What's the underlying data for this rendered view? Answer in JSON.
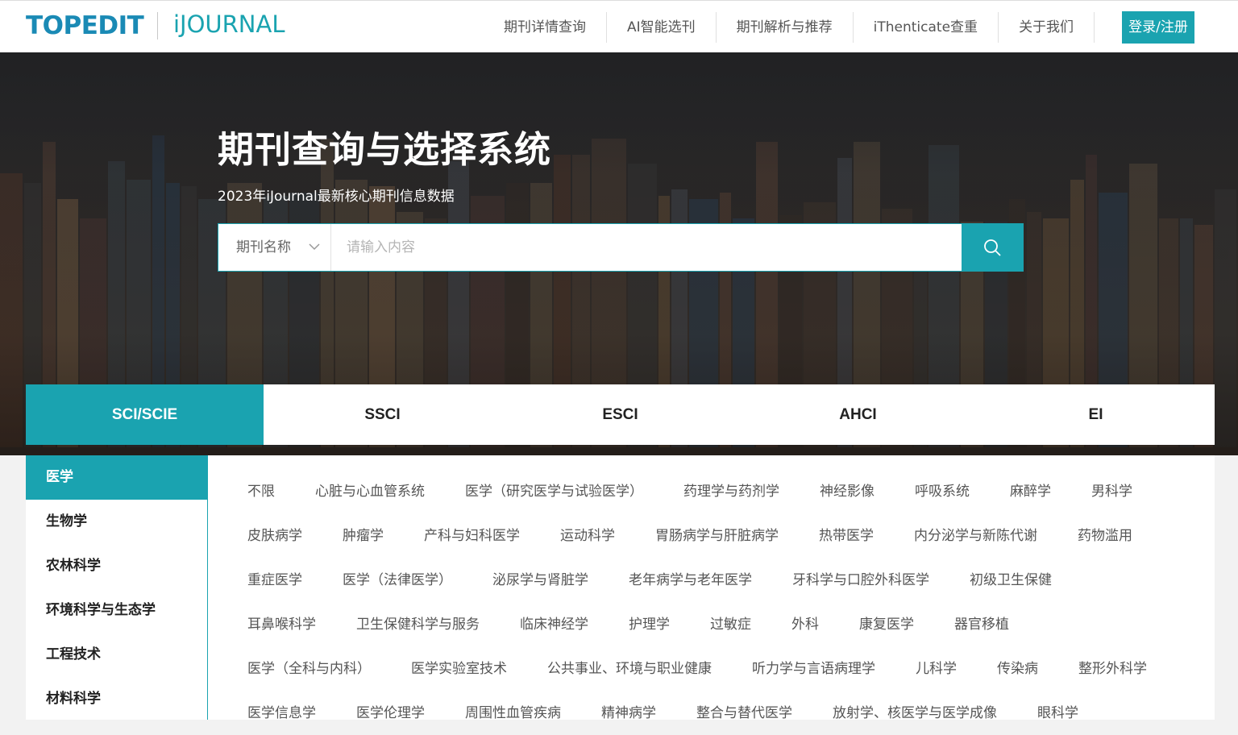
{
  "header": {
    "logo_primary": "TOPEDIT",
    "logo_secondary": "iJOURNAL",
    "nav": [
      "期刊详情查询",
      "AI智能选刊",
      "期刊解析与推荐",
      "iThenticate查重",
      "关于我们"
    ],
    "login_label": "登录/注册"
  },
  "hero": {
    "title": "期刊查询与选择系统",
    "subtitle": "2023年iJournal最新核心期刊信息数据",
    "search": {
      "type_selected": "期刊名称",
      "placeholder": "请输入内容"
    }
  },
  "tabs": [
    {
      "label": "SCI/SCIE",
      "active": true
    },
    {
      "label": "SSCI",
      "active": false
    },
    {
      "label": "ESCI",
      "active": false
    },
    {
      "label": "AHCI",
      "active": false
    },
    {
      "label": "EI",
      "active": false
    }
  ],
  "sidebar": {
    "items": [
      {
        "label": "医学",
        "active": true
      },
      {
        "label": "生物学",
        "active": false
      },
      {
        "label": "农林科学",
        "active": false
      },
      {
        "label": "环境科学与生态学",
        "active": false
      },
      {
        "label": "工程技术",
        "active": false
      },
      {
        "label": "材料科学",
        "active": false
      }
    ]
  },
  "subjects": [
    [
      "不限",
      "心脏与心血管系统",
      "医学（研究医学与试验医学）",
      "药理学与药剂学",
      "神经影像",
      "呼吸系统",
      "麻醉学",
      "男科学"
    ],
    [
      "皮肤病学",
      "肿瘤学",
      "产科与妇科医学",
      "运动科学",
      "胃肠病学与肝脏病学",
      "热带医学",
      "内分泌学与新陈代谢",
      "药物滥用"
    ],
    [
      "重症医学",
      "医学（法律医学）",
      "泌尿学与肾脏学",
      "老年病学与老年医学",
      "牙科学与口腔外科医学",
      "初级卫生保健"
    ],
    [
      "耳鼻喉科学",
      "卫生保健科学与服务",
      "临床神经学",
      "护理学",
      "过敏症",
      "外科",
      "康复医学",
      "器官移植"
    ],
    [
      "医学（全科与内科）",
      "医学实验室技术",
      "公共事业、环境与职业健康",
      "听力学与言语病理学",
      "儿科学",
      "传染病",
      "整形外科学"
    ],
    [
      "医学信息学",
      "医学伦理学",
      "周围性血管疾病",
      "精神病学",
      "整合与替代医学",
      "放射学、核医学与医学成像",
      "眼科学"
    ]
  ],
  "colors": {
    "accent": "#1aa3b0",
    "logo_blue": "#1a8ab5"
  }
}
